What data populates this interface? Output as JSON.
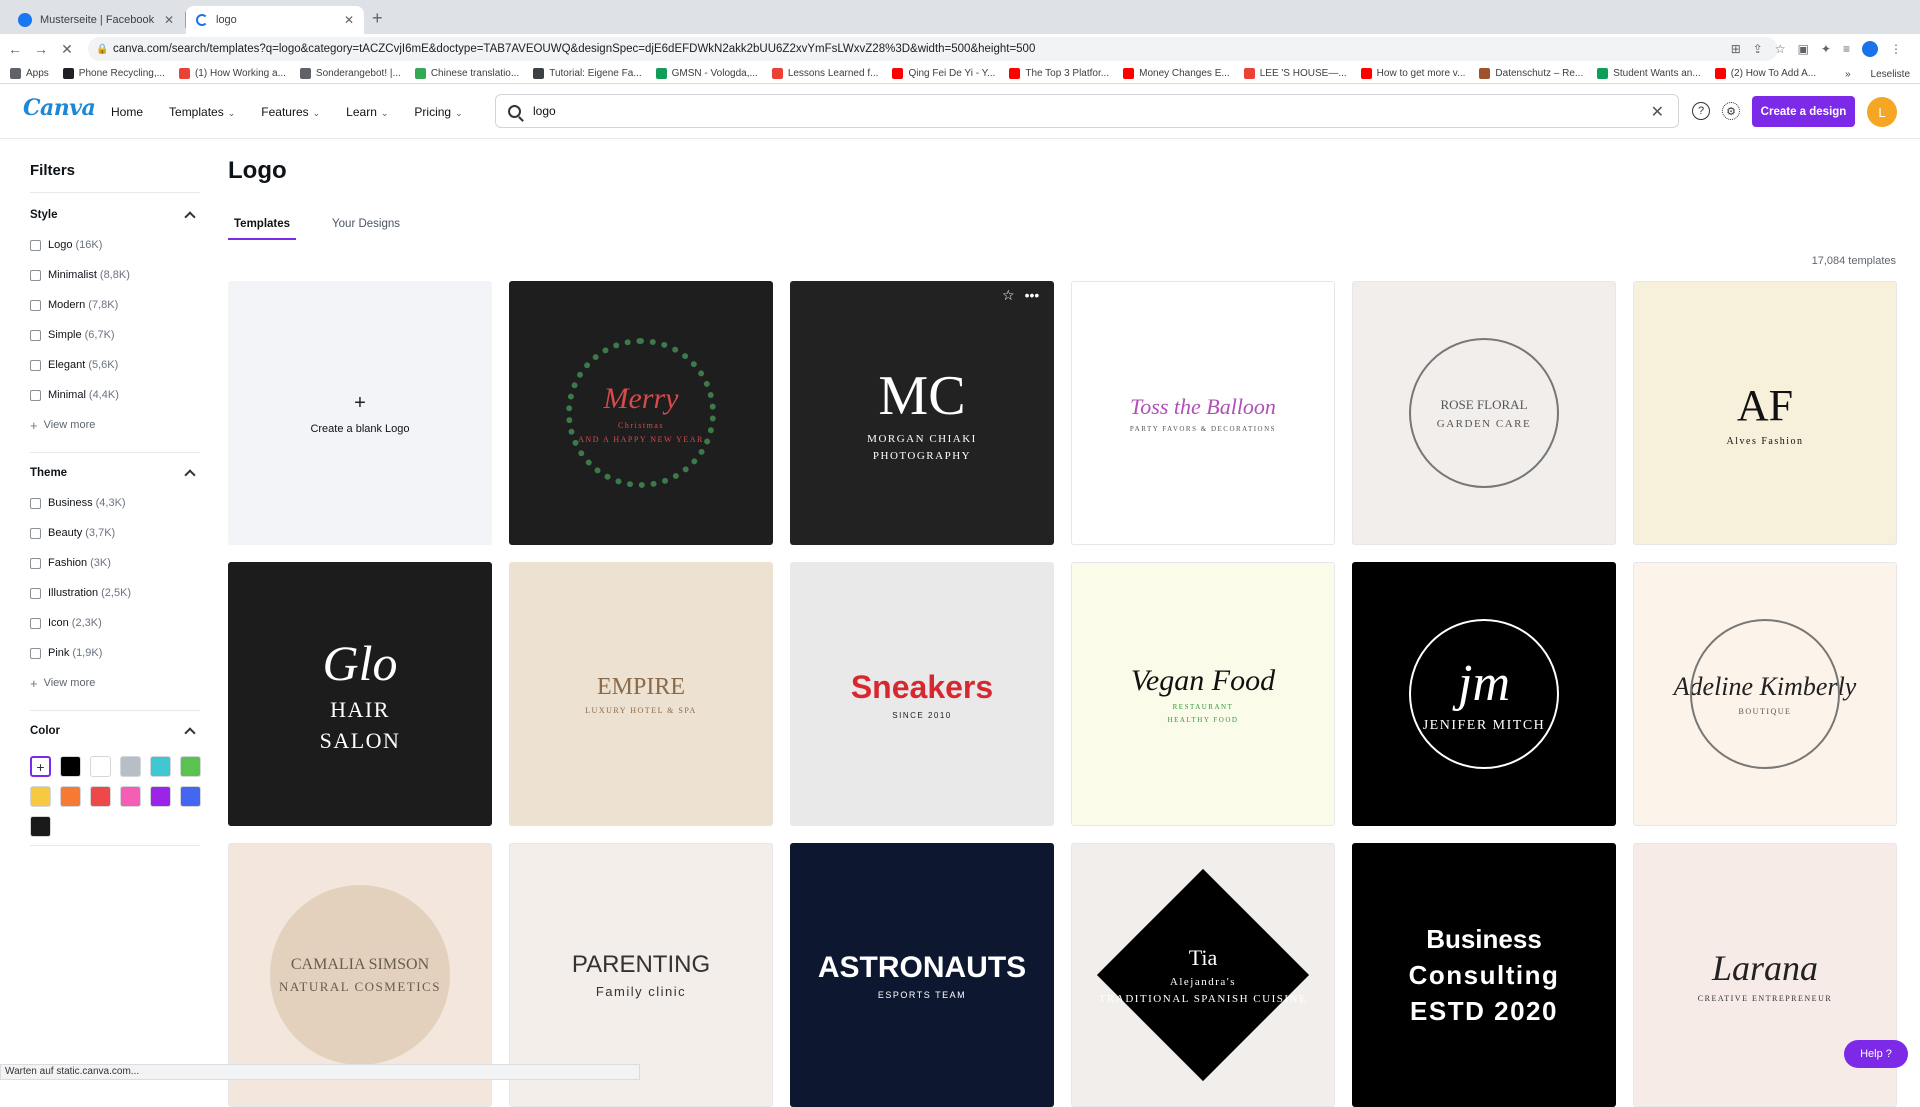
{
  "browser": {
    "tabs": [
      {
        "title": "Musterseite | Facebook",
        "icon": "facebook-icon"
      },
      {
        "title": "logo",
        "icon": "loading-spinner-icon"
      }
    ],
    "url": "canva.com/search/templates?q=logo&category=tACZCvjI6mE&doctype=TAB7AVEOUWQ&designSpec=djE6dEFDWkN2akk2bUU6Z2xvYmFsLWxvZ28%3D&width=500&height=500",
    "bookmarks": [
      "Apps",
      "Phone Recycling,...",
      "(1) How Working a...",
      "Sonderangebot! |...",
      "Chinese translatio...",
      "Tutorial: Eigene Fa...",
      "GMSN - Vologda,...",
      "Lessons Learned f...",
      "Qing Fei De Yi - Y...",
      "The Top 3 Platfor...",
      "Money Changes E...",
      "LEE 'S HOUSE—...",
      "How to get more v...",
      "Datenschutz – Re...",
      "Student Wants an...",
      "(2) How To Add A..."
    ],
    "reading_list": "Leseliste",
    "status": "Warten auf static.canva.com..."
  },
  "header": {
    "logo": "Canva",
    "nav": [
      "Home",
      "Templates",
      "Features",
      "Learn",
      "Pricing"
    ],
    "search_value": "logo",
    "create_label": "Create a design",
    "avatar_letter": "L"
  },
  "sidebar": {
    "title": "Filters",
    "style": {
      "label": "Style",
      "options": [
        {
          "label": "Logo",
          "count": "(16K)"
        },
        {
          "label": "Minimalist",
          "count": "(8,8K)"
        },
        {
          "label": "Modern",
          "count": "(7,8K)"
        },
        {
          "label": "Simple",
          "count": "(6,7K)"
        },
        {
          "label": "Elegant",
          "count": "(5,6K)"
        },
        {
          "label": "Minimal",
          "count": "(4,4K)"
        }
      ],
      "view_more": "View more"
    },
    "theme": {
      "label": "Theme",
      "options": [
        {
          "label": "Business",
          "count": "(4,3K)"
        },
        {
          "label": "Beauty",
          "count": "(3,7K)"
        },
        {
          "label": "Fashion",
          "count": "(3K)"
        },
        {
          "label": "Illustration",
          "count": "(2,5K)"
        },
        {
          "label": "Icon",
          "count": "(2,3K)"
        },
        {
          "label": "Pink",
          "count": "(1,9K)"
        }
      ],
      "view_more": "View more"
    },
    "color": {
      "label": "Color",
      "swatches": [
        "#000000",
        "#ffffff",
        "#b8bec5",
        "#3ec7d1",
        "#5cc24f",
        "#f7c940",
        "#f77a34",
        "#ee4848",
        "#f45eb4",
        "#9b24e8",
        "#4466f0",
        "#1a1a1a"
      ]
    }
  },
  "main": {
    "title": "Logo",
    "tabs": [
      "Templates",
      "Your Designs"
    ],
    "template_count": "17,084 templates",
    "blank_label": "Create a blank Logo",
    "help_label": "Help ?"
  },
  "templates": [
    {
      "bg": "#1e1e1e",
      "lines": [
        "Merry",
        "Christmas",
        "AND A HAPPY NEW YEAR"
      ]
    },
    {
      "bg": "#222222",
      "lines": [
        "MC",
        "MORGAN CHIAKI",
        "PHOTOGRAPHY"
      ]
    },
    {
      "bg": "#ffffff",
      "lines": [
        "Toss the Balloon",
        "PARTY FAVORS & DECORATIONS"
      ]
    },
    {
      "bg": "#f1eeec",
      "lines": [
        "ROSE FLORAL",
        "GARDEN CARE"
      ]
    },
    {
      "bg": "#f7f1dc",
      "lines": [
        "AF",
        "Alves Fashion"
      ]
    },
    {
      "bg": "#1c1c1c",
      "lines": [
        "Glo",
        "HAIR",
        "SALON"
      ]
    },
    {
      "bg": "#ede1d1",
      "lines": [
        "EMPIRE",
        "LUXURY HOTEL & SPA"
      ]
    },
    {
      "bg": "#e9e9e9",
      "lines": [
        "Sneakers",
        "SINCE 2010"
      ]
    },
    {
      "bg": "#fbfbe9",
      "lines": [
        "Vegan Food",
        "RESTAURANT",
        "HEALTHY FOOD"
      ]
    },
    {
      "bg": "#000000",
      "lines": [
        "jm",
        "JENIFER MITCH"
      ]
    },
    {
      "bg": "#fcf4ea",
      "lines": [
        "Adeline Kimberly",
        "BOUTIQUE"
      ]
    },
    {
      "bg": "#f3e6dd",
      "lines": [
        "CAMALIA SIMSON",
        "NATURAL COSMETICS"
      ]
    },
    {
      "bg": "#f4eeeb",
      "lines": [
        "PARENTING",
        "Family clinic"
      ]
    },
    {
      "bg": "#0d1730",
      "lines": [
        "ASTRONAUTS",
        "ESPORTS TEAM"
      ]
    },
    {
      "bg": "#f1eeec",
      "lines": [
        "Tia",
        "Alejandra's",
        "TRADITIONAL SPANISH CUISINE"
      ]
    },
    {
      "bg": "#000000",
      "lines": [
        "Business",
        "Consulting",
        "ESTD 2020"
      ]
    },
    {
      "bg": "#f6ebe6",
      "lines": [
        "Larana",
        "CREATIVE ENTREPRENEUR"
      ]
    }
  ]
}
